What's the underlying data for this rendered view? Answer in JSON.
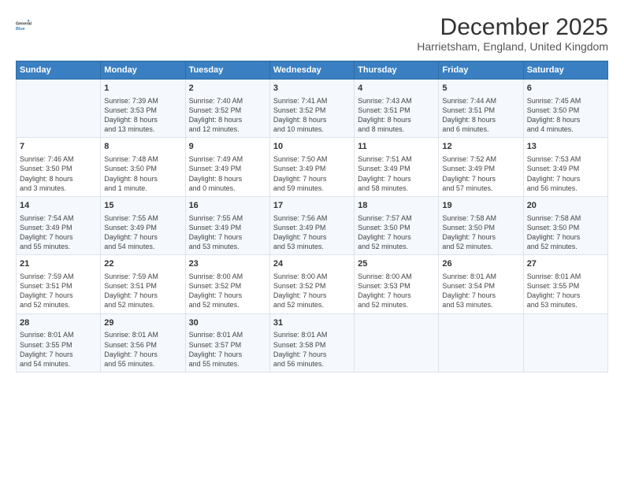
{
  "logo": {
    "line1": "General",
    "line2": "Blue"
  },
  "title": "December 2025",
  "subtitle": "Harrietsham, England, United Kingdom",
  "header_days": [
    "Sunday",
    "Monday",
    "Tuesday",
    "Wednesday",
    "Thursday",
    "Friday",
    "Saturday"
  ],
  "weeks": [
    [
      {
        "day": "",
        "info": ""
      },
      {
        "day": "1",
        "info": "Sunrise: 7:39 AM\nSunset: 3:53 PM\nDaylight: 8 hours\nand 13 minutes."
      },
      {
        "day": "2",
        "info": "Sunrise: 7:40 AM\nSunset: 3:52 PM\nDaylight: 8 hours\nand 12 minutes."
      },
      {
        "day": "3",
        "info": "Sunrise: 7:41 AM\nSunset: 3:52 PM\nDaylight: 8 hours\nand 10 minutes."
      },
      {
        "day": "4",
        "info": "Sunrise: 7:43 AM\nSunset: 3:51 PM\nDaylight: 8 hours\nand 8 minutes."
      },
      {
        "day": "5",
        "info": "Sunrise: 7:44 AM\nSunset: 3:51 PM\nDaylight: 8 hours\nand 6 minutes."
      },
      {
        "day": "6",
        "info": "Sunrise: 7:45 AM\nSunset: 3:50 PM\nDaylight: 8 hours\nand 4 minutes."
      }
    ],
    [
      {
        "day": "7",
        "info": "Sunrise: 7:46 AM\nSunset: 3:50 PM\nDaylight: 8 hours\nand 3 minutes."
      },
      {
        "day": "8",
        "info": "Sunrise: 7:48 AM\nSunset: 3:50 PM\nDaylight: 8 hours\nand 1 minute."
      },
      {
        "day": "9",
        "info": "Sunrise: 7:49 AM\nSunset: 3:49 PM\nDaylight: 8 hours\nand 0 minutes."
      },
      {
        "day": "10",
        "info": "Sunrise: 7:50 AM\nSunset: 3:49 PM\nDaylight: 7 hours\nand 59 minutes."
      },
      {
        "day": "11",
        "info": "Sunrise: 7:51 AM\nSunset: 3:49 PM\nDaylight: 7 hours\nand 58 minutes."
      },
      {
        "day": "12",
        "info": "Sunrise: 7:52 AM\nSunset: 3:49 PM\nDaylight: 7 hours\nand 57 minutes."
      },
      {
        "day": "13",
        "info": "Sunrise: 7:53 AM\nSunset: 3:49 PM\nDaylight: 7 hours\nand 56 minutes."
      }
    ],
    [
      {
        "day": "14",
        "info": "Sunrise: 7:54 AM\nSunset: 3:49 PM\nDaylight: 7 hours\nand 55 minutes."
      },
      {
        "day": "15",
        "info": "Sunrise: 7:55 AM\nSunset: 3:49 PM\nDaylight: 7 hours\nand 54 minutes."
      },
      {
        "day": "16",
        "info": "Sunrise: 7:55 AM\nSunset: 3:49 PM\nDaylight: 7 hours\nand 53 minutes."
      },
      {
        "day": "17",
        "info": "Sunrise: 7:56 AM\nSunset: 3:49 PM\nDaylight: 7 hours\nand 53 minutes."
      },
      {
        "day": "18",
        "info": "Sunrise: 7:57 AM\nSunset: 3:50 PM\nDaylight: 7 hours\nand 52 minutes."
      },
      {
        "day": "19",
        "info": "Sunrise: 7:58 AM\nSunset: 3:50 PM\nDaylight: 7 hours\nand 52 minutes."
      },
      {
        "day": "20",
        "info": "Sunrise: 7:58 AM\nSunset: 3:50 PM\nDaylight: 7 hours\nand 52 minutes."
      }
    ],
    [
      {
        "day": "21",
        "info": "Sunrise: 7:59 AM\nSunset: 3:51 PM\nDaylight: 7 hours\nand 52 minutes."
      },
      {
        "day": "22",
        "info": "Sunrise: 7:59 AM\nSunset: 3:51 PM\nDaylight: 7 hours\nand 52 minutes."
      },
      {
        "day": "23",
        "info": "Sunrise: 8:00 AM\nSunset: 3:52 PM\nDaylight: 7 hours\nand 52 minutes."
      },
      {
        "day": "24",
        "info": "Sunrise: 8:00 AM\nSunset: 3:52 PM\nDaylight: 7 hours\nand 52 minutes."
      },
      {
        "day": "25",
        "info": "Sunrise: 8:00 AM\nSunset: 3:53 PM\nDaylight: 7 hours\nand 52 minutes."
      },
      {
        "day": "26",
        "info": "Sunrise: 8:01 AM\nSunset: 3:54 PM\nDaylight: 7 hours\nand 53 minutes."
      },
      {
        "day": "27",
        "info": "Sunrise: 8:01 AM\nSunset: 3:55 PM\nDaylight: 7 hours\nand 53 minutes."
      }
    ],
    [
      {
        "day": "28",
        "info": "Sunrise: 8:01 AM\nSunset: 3:55 PM\nDaylight: 7 hours\nand 54 minutes."
      },
      {
        "day": "29",
        "info": "Sunrise: 8:01 AM\nSunset: 3:56 PM\nDaylight: 7 hours\nand 55 minutes."
      },
      {
        "day": "30",
        "info": "Sunrise: 8:01 AM\nSunset: 3:57 PM\nDaylight: 7 hours\nand 55 minutes."
      },
      {
        "day": "31",
        "info": "Sunrise: 8:01 AM\nSunset: 3:58 PM\nDaylight: 7 hours\nand 56 minutes."
      },
      {
        "day": "",
        "info": ""
      },
      {
        "day": "",
        "info": ""
      },
      {
        "day": "",
        "info": ""
      }
    ]
  ]
}
